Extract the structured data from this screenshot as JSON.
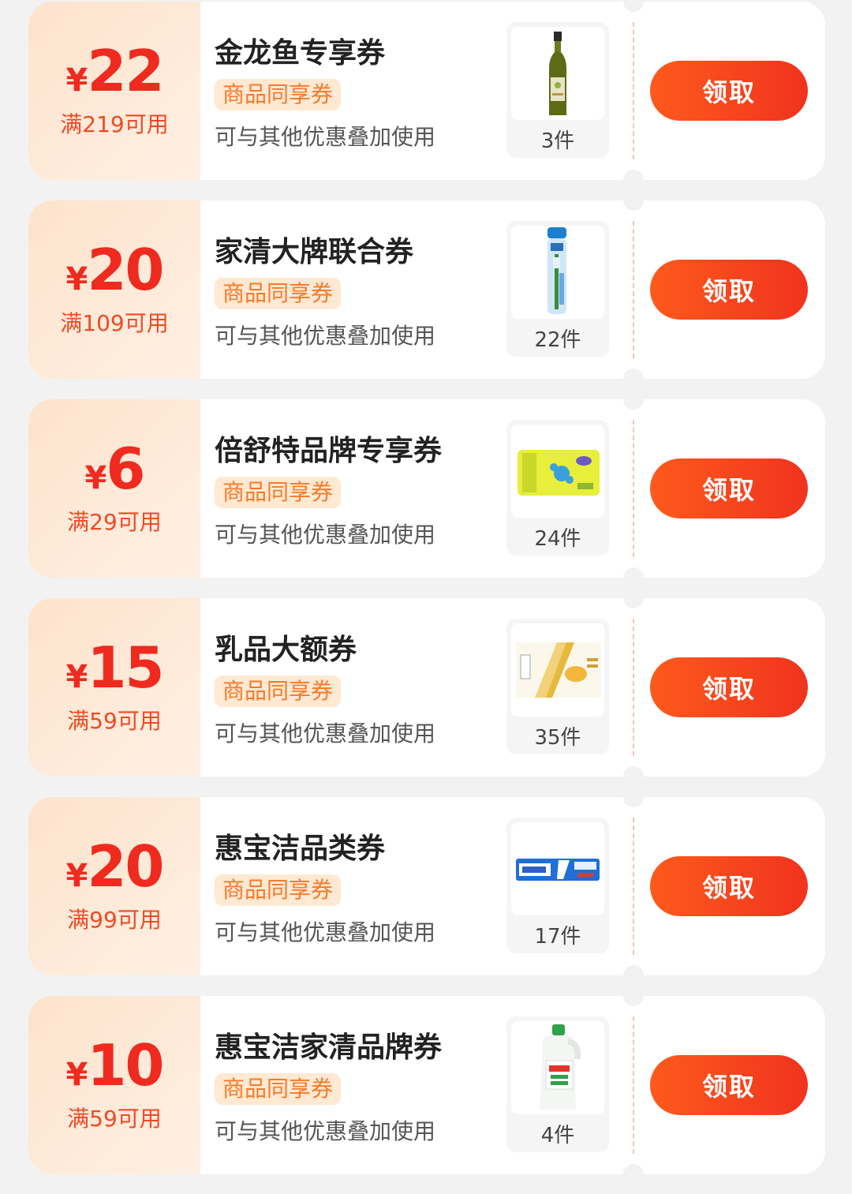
{
  "coupons": [
    {
      "currency": "¥",
      "amount": "22",
      "threshold": "满219可用",
      "title": "金龙鱼专享券",
      "tag": "商品同享券",
      "note": "可与其他优惠叠加使用",
      "count": "3件",
      "product_icon": "oil-bottle-icon",
      "button": "领取"
    },
    {
      "currency": "¥",
      "amount": "20",
      "threshold": "满109可用",
      "title": "家清大牌联合券",
      "tag": "商品同享券",
      "note": "可与其他优惠叠加使用",
      "count": "22件",
      "product_icon": "toothbrush-tube-icon",
      "button": "领取"
    },
    {
      "currency": "¥",
      "amount": "6",
      "threshold": "满29可用",
      "title": "倍舒特品牌专享券",
      "tag": "商品同享券",
      "note": "可与其他优惠叠加使用",
      "count": "24件",
      "product_icon": "sanitary-pad-pack-icon",
      "button": "领取"
    },
    {
      "currency": "¥",
      "amount": "15",
      "threshold": "满59可用",
      "title": "乳品大额券",
      "tag": "商品同享券",
      "note": "可与其他优惠叠加使用",
      "count": "35件",
      "product_icon": "milk-box-icon",
      "button": "领取"
    },
    {
      "currency": "¥",
      "amount": "20",
      "threshold": "满99可用",
      "title": "惠宝洁品类券",
      "tag": "商品同享券",
      "note": "可与其他优惠叠加使用",
      "count": "17件",
      "product_icon": "toothpaste-icon",
      "button": "领取"
    },
    {
      "currency": "¥",
      "amount": "10",
      "threshold": "满59可用",
      "title": "惠宝洁家清品牌券",
      "tag": "商品同享券",
      "note": "可与其他优惠叠加使用",
      "count": "4件",
      "product_icon": "detergent-bottle-icon",
      "button": "领取"
    }
  ],
  "colors": {
    "accent": "#ef2a1f",
    "button_start": "#fe5a1c",
    "button_end": "#f0331e",
    "tag_bg": "#ffe9d2",
    "tag_text": "#f77a2b",
    "amount_panel": "#fde3cc"
  }
}
